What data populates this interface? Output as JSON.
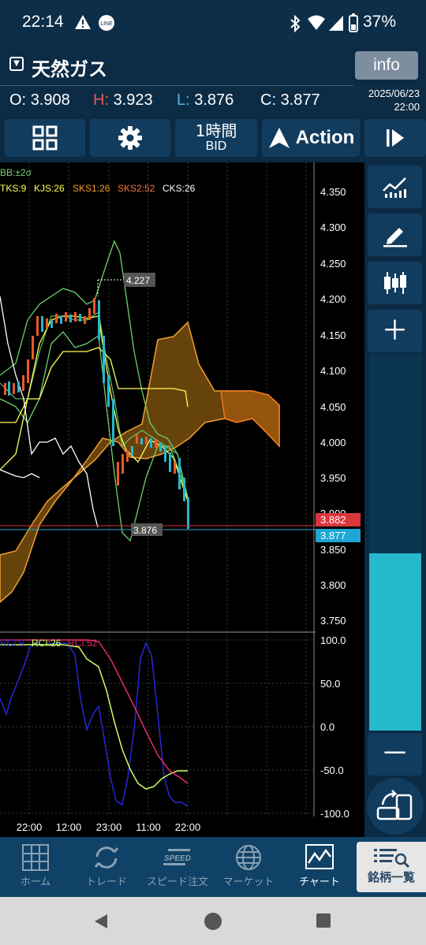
{
  "status_bar": {
    "time": "22:14",
    "battery": "37%"
  },
  "header": {
    "title": "天然ガス",
    "info_label": "info",
    "open_label": "O:",
    "open_value": "3.908",
    "high_label": "H:",
    "high_value": "3.923",
    "low_label": "L:",
    "low_value": "3.876",
    "close_label": "C:",
    "close_value": "3.877",
    "date": "2025/06/23",
    "time": "22:00"
  },
  "toolbar": {
    "timeframe": "1時間",
    "price_type": "BID",
    "action_label": "Action"
  },
  "chart": {
    "bb_legend": "BB:±2σ",
    "ichimoku_legend": {
      "tks": "TKS:9",
      "kjs": "KJS:26",
      "sks1": "SKS1:26",
      "sks2": "SKS2:52",
      "cks": "CKS:26"
    },
    "price_axis": [
      "4.350",
      "4.300",
      "4.250",
      "4.200",
      "4.150",
      "4.100",
      "4.050",
      "4.000",
      "3.950",
      "3.900",
      "3.850",
      "3.800",
      "3.750"
    ],
    "ask_badge": "3.882",
    "bid_badge": "3.877",
    "high_marker": "4.227",
    "low_marker": "3.876",
    "rci_legend": {
      "rci1": "RCI:9",
      "rci2": "RCI:26",
      "rci3": "RCI:52"
    },
    "rci_axis": [
      "100.0",
      "50.0",
      "0.0",
      "-50.0",
      "-100.0"
    ],
    "time_axis": [
      "22:00",
      "12:00",
      "23:00",
      "11:00",
      "22:00"
    ]
  },
  "nav": {
    "items": [
      {
        "label": "ホーム"
      },
      {
        "label": "トレード"
      },
      {
        "label": "スピード注文"
      },
      {
        "label": "マーケット"
      },
      {
        "label": "チャート"
      }
    ],
    "list_label": "銘柄一覧"
  },
  "colors": {
    "accent": "#26b8cc",
    "ask": "#d9363e",
    "bid": "#1ea6d4",
    "cloud": "#f0a030",
    "tks": "#ffff55",
    "kjs": "#ffff55",
    "bb": "#7ad27a"
  }
}
